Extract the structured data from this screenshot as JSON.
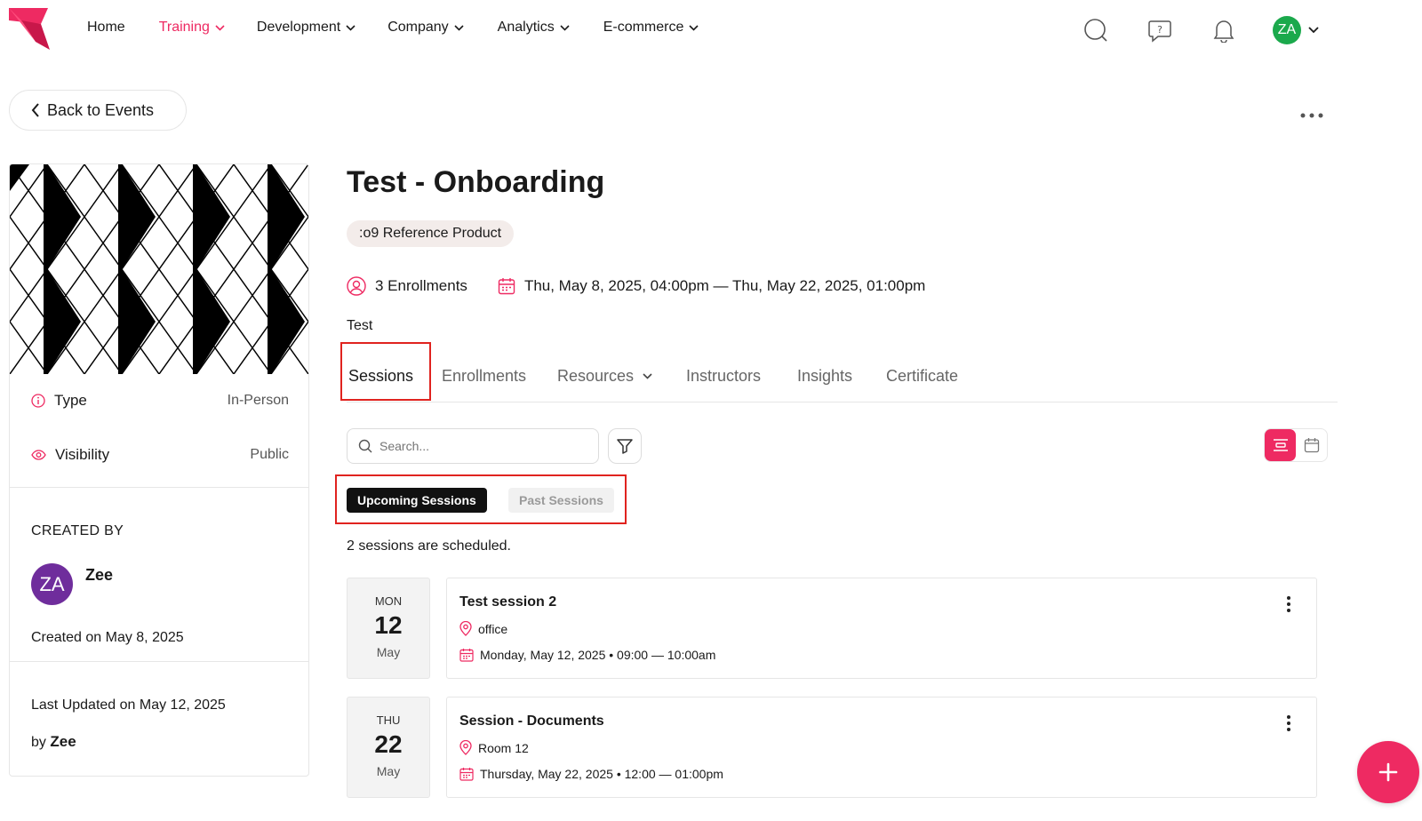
{
  "nav": {
    "links": [
      {
        "label": "Home",
        "dropdown": false,
        "active": false
      },
      {
        "label": "Training",
        "dropdown": true,
        "active": true
      },
      {
        "label": "Development",
        "dropdown": true,
        "active": false
      },
      {
        "label": "Company",
        "dropdown": true,
        "active": false
      },
      {
        "label": "Analytics",
        "dropdown": true,
        "active": false
      },
      {
        "label": "E-commerce",
        "dropdown": true,
        "active": false
      }
    ],
    "user_initials": "ZA",
    "icons": [
      "search-icon",
      "help-chat-icon",
      "bell-icon",
      "chevron-down-icon"
    ]
  },
  "back_label": "Back to Events",
  "sidebar": {
    "type_label": "Type",
    "type_value": "In-Person",
    "visibility_label": "Visibility",
    "visibility_value": "Public",
    "created_by_label": "CREATED BY",
    "creator_initials": "ZA",
    "creator_name": "Zee",
    "created_on": "Created on May 8, 2025",
    "last_updated": "Last Updated on May 12, 2025",
    "by_prefix": "by",
    "by_name": "Zee"
  },
  "event": {
    "title": "Test - Onboarding",
    "product_chip": ":o9 Reference Product",
    "enrollments": "3 Enrollments",
    "date_range": "Thu, May 8, 2025, 04:00pm — Thu, May 22, 2025, 01:00pm",
    "description": "Test"
  },
  "tabs": [
    "Sessions",
    "Enrollments",
    "Resources",
    "Instructors",
    "Insights",
    "Certificate"
  ],
  "search": {
    "placeholder": "Search..."
  },
  "session_filters": {
    "upcoming": "Upcoming Sessions",
    "past": "Past Sessions"
  },
  "sessions_count": "2 sessions are scheduled.",
  "sessions": [
    {
      "dow": "MON",
      "day": "12",
      "month": "May",
      "title": "Test session 2",
      "location": "office",
      "time": "Monday, May 12, 2025 • 09:00 — 10:00am"
    },
    {
      "dow": "THU",
      "day": "22",
      "month": "May",
      "title": "Session - Documents",
      "location": "Room 12",
      "time": "Thursday, May 22, 2025 • 12:00 — 01:00pm"
    }
  ],
  "colors": {
    "accent": "#ee2a62",
    "highlight_box": "#e0231f",
    "avatar_nav": "#1ba94c",
    "avatar_creator": "#6f2d9c"
  }
}
